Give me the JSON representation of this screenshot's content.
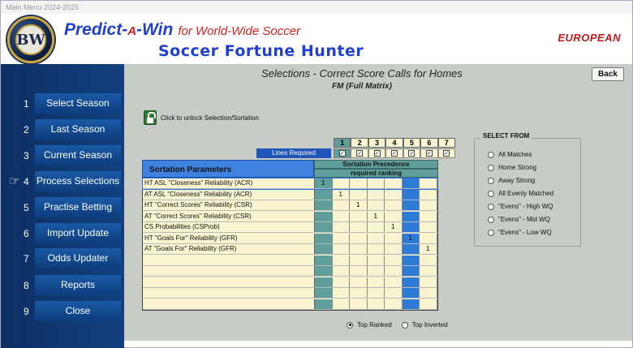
{
  "window": {
    "title": "Main Menu 2024-2025"
  },
  "banner": {
    "logo_text": "BW",
    "brand_prefix": "Predict-",
    "brand_a": "A",
    "brand_suffix": "-Win",
    "brand_sub": "for World-Wide Soccer",
    "brand_line2": "Soccer Fortune Hunter",
    "region": "EUROPEAN"
  },
  "sidebar": {
    "items": [
      {
        "num": "1",
        "label": "Select Season"
      },
      {
        "num": "2",
        "label": "Last Season"
      },
      {
        "num": "3",
        "label": "Current Season"
      },
      {
        "num": "4",
        "label": "Process Selections"
      },
      {
        "num": "5",
        "label": "Practise Betting"
      },
      {
        "num": "6",
        "label": "Import Update"
      },
      {
        "num": "7",
        "label": "Odds Updater"
      },
      {
        "num": "8",
        "label": "Reports"
      },
      {
        "num": "9",
        "label": "Close"
      }
    ]
  },
  "panel": {
    "title": "Selections - Correct Score Calls for Homes",
    "subtitle": "FM (Full Matrix)",
    "back_label": "Back",
    "lock_label": "Click to unlock Selection/Sortation"
  },
  "grid": {
    "column_numbers": [
      "1",
      "2",
      "3",
      "4",
      "5",
      "6",
      "7"
    ],
    "lines_required_label": "Lines Required",
    "checks": [
      "✓",
      "✓",
      "✓",
      "✓",
      "✓",
      "✓",
      "✓"
    ],
    "params_header": "Sortation Parameters",
    "precedence_header": "Sortation Precedence",
    "ranking_header": "required ranking",
    "rows": [
      {
        "name": "HT ASL \"Closeness\" Reliability (ACR)",
        "cells": [
          "1",
          "",
          "",
          "",
          "",
          "",
          ""
        ]
      },
      {
        "name": "AT ASL \"Closeness\" Reliability (ACR)",
        "cells": [
          "",
          "1",
          "",
          "",
          "",
          "",
          ""
        ]
      },
      {
        "name": "HT \"Correct Scores\" Reliability (CSR)",
        "cells": [
          "",
          "",
          "1",
          "",
          "",
          "",
          ""
        ]
      },
      {
        "name": "AT \"Correct Scores\" Reliability (CSR)",
        "cells": [
          "",
          "",
          "",
          "1",
          "",
          "",
          ""
        ]
      },
      {
        "name": "CS Probabilities (CSProb)",
        "cells": [
          "",
          "",
          "",
          "",
          "1",
          "",
          ""
        ]
      },
      {
        "name": "HT \"Goals For\" Reliability (GFR)",
        "cells": [
          "",
          "",
          "",
          "",
          "",
          "1",
          ""
        ]
      },
      {
        "name": "AT \"Goals For\" Reliability (GFR)",
        "cells": [
          "",
          "",
          "",
          "",
          "",
          "",
          "1"
        ]
      },
      {
        "name": "",
        "cells": [
          "",
          "",
          "",
          "",
          "",
          "",
          ""
        ]
      },
      {
        "name": "",
        "cells": [
          "",
          "",
          "",
          "",
          "",
          "",
          ""
        ]
      },
      {
        "name": "",
        "cells": [
          "",
          "",
          "",
          "",
          "",
          "",
          ""
        ]
      },
      {
        "name": "",
        "cells": [
          "",
          "",
          "",
          "",
          "",
          "",
          ""
        ]
      },
      {
        "name": "",
        "cells": [
          "",
          "",
          "",
          "",
          "",
          "",
          ""
        ]
      }
    ]
  },
  "select_from": {
    "title": "SELECT FROM",
    "options": [
      {
        "label": "All Matches",
        "checked": false
      },
      {
        "label": "Home Strong",
        "checked": false
      },
      {
        "label": "Away Strong",
        "checked": false
      },
      {
        "label": "All Evenly Matched",
        "checked": false
      },
      {
        "label": "\"Evens\" - High WQ",
        "checked": false
      },
      {
        "label": "\"Evens\" - Mid WQ",
        "checked": false
      },
      {
        "label": "\"Evens\" - Low WQ",
        "checked": false
      }
    ]
  },
  "ranking_mode": {
    "options": [
      {
        "label": "Top Ranked",
        "checked": true
      },
      {
        "label": "Top Inverted",
        "checked": false
      }
    ]
  },
  "colors": {
    "sidebar": "#0d2f63",
    "menu_button": "#1a5aa6",
    "panel": "#c7ccc6",
    "teal_column": "#5f9e9a",
    "blue_column": "#2d7bd6",
    "grid_bg": "#f7f4cf",
    "brand_blue": "#1f3fd4",
    "brand_red": "#d62020"
  }
}
